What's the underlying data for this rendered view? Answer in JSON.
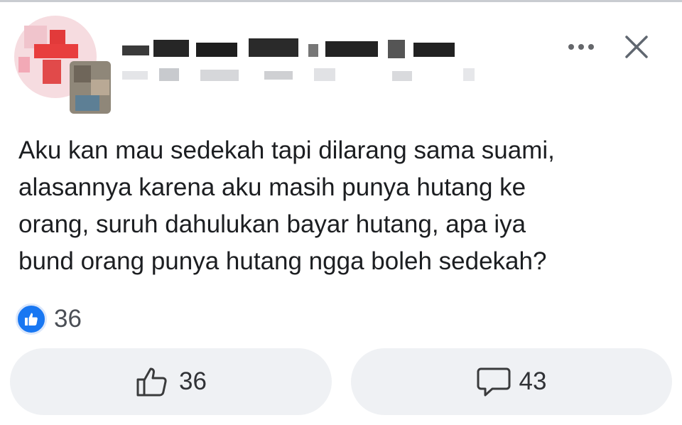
{
  "post": {
    "text_lines": [
      "Aku kan mau sedekah tapi dilarang sama suami,",
      "alasannya karena aku masih punya hutang ke",
      "orang, suruh dahulukan bayar hutang, apa iya",
      "bund orang punya hutang ngga boleh sedekah?"
    ]
  },
  "header": {
    "author_name_icon": "pixelated-name",
    "author_meta_icon": "pixelated-meta",
    "more_icon": "more-dots-icon",
    "close_icon": "close-icon"
  },
  "reactions": {
    "summary_icon": "like-reaction-icon",
    "summary_count": "36",
    "colors": {
      "like_blue": "#1877f2",
      "button_bg": "#eff1f4",
      "text": "#1c1e21"
    }
  },
  "actions": {
    "like": {
      "icon": "thumbs-up-outline-icon",
      "count": "36"
    },
    "comment": {
      "icon": "comment-bubble-icon",
      "count": "43"
    }
  }
}
